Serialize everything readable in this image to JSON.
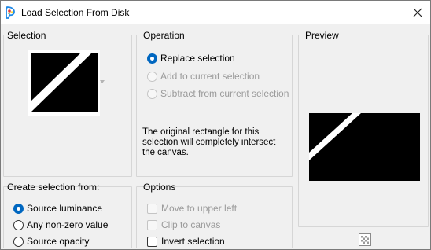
{
  "window": {
    "title": "Load Selection From Disk"
  },
  "selection_panel": {
    "heading": "Selection"
  },
  "operation_panel": {
    "heading": "Operation",
    "options": [
      {
        "label": "Replace selection",
        "checked": true,
        "disabled": false
      },
      {
        "label": "Add to current selection",
        "checked": false,
        "disabled": true
      },
      {
        "label": "Subtract from current selection",
        "checked": false,
        "disabled": true
      }
    ],
    "description_lines": [
      "The original rectangle for this",
      "selection will completely intersect",
      "the canvas."
    ]
  },
  "preview_panel": {
    "heading": "Preview"
  },
  "create_panel": {
    "heading": "Create selection from:",
    "options": [
      {
        "label": "Source luminance",
        "checked": true
      },
      {
        "label": "Any non-zero value",
        "checked": false
      },
      {
        "label": "Source opacity",
        "checked": false
      }
    ]
  },
  "options_panel": {
    "heading": "Options",
    "items": [
      {
        "label": "Move to upper left",
        "checked": false,
        "disabled": true
      },
      {
        "label": "Clip to canvas",
        "checked": false,
        "disabled": true
      },
      {
        "label": "Invert selection",
        "checked": false,
        "disabled": false
      }
    ]
  },
  "icons": {
    "app": "paint-shop-pro-icon",
    "close": "close-icon",
    "dropdown": "chevron-down-icon",
    "preview_toggle": "checkerboard-icon"
  },
  "colors": {
    "accent": "#0067c0",
    "shape_fill": "#000000",
    "stripe": "#ffffff"
  }
}
